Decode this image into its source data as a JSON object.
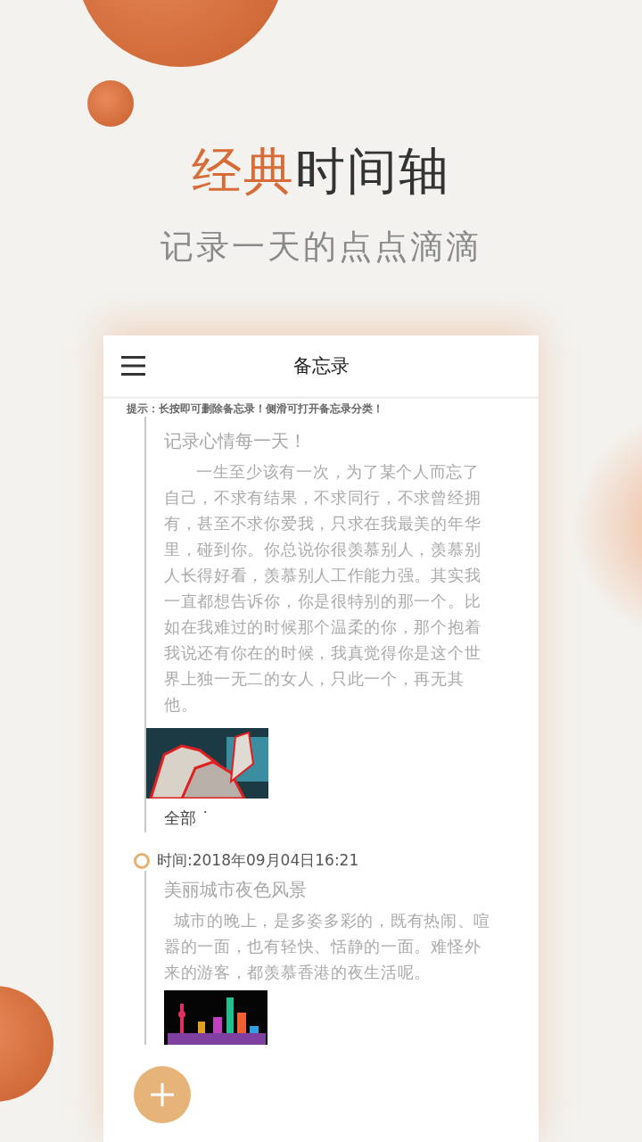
{
  "headline": {
    "accent": "经典",
    "rest": "时间轴"
  },
  "subtitle": "记录一天的点点滴滴",
  "app": {
    "title": "备忘录",
    "hint": "提示：长按即可删除备忘录！侧滑可打开备忘录分类！",
    "entries": [
      {
        "title": "记录心情每一天！",
        "body": "一生至少该有一次，为了某个人而忘了自己，不求有结果，不求同行，不求曾经拥有，甚至不求你爱我，只求在我最美的年华里，碰到你。你总说你很羡慕别人，羡慕别人长得好看，羡慕别人工作能力强。其实我一直都想告诉你，你是很特别的那一个。比如在我难过的时候那个温柔的你，那个抱着我说还有你在的时候，我真觉得你是这个世界上独一无二的女人，只此一个，再无其他。",
        "category": "全部 ˙"
      },
      {
        "time": "时间:2018年09月04日16:21",
        "title": "美丽城市夜色风景",
        "body": "城市的晚上，是多姿多彩的，既有热闹、喧嚣的一面，也有轻快、恬静的一面。难怪外来的游客，都羡慕香港的夜生活呢。"
      }
    ]
  }
}
